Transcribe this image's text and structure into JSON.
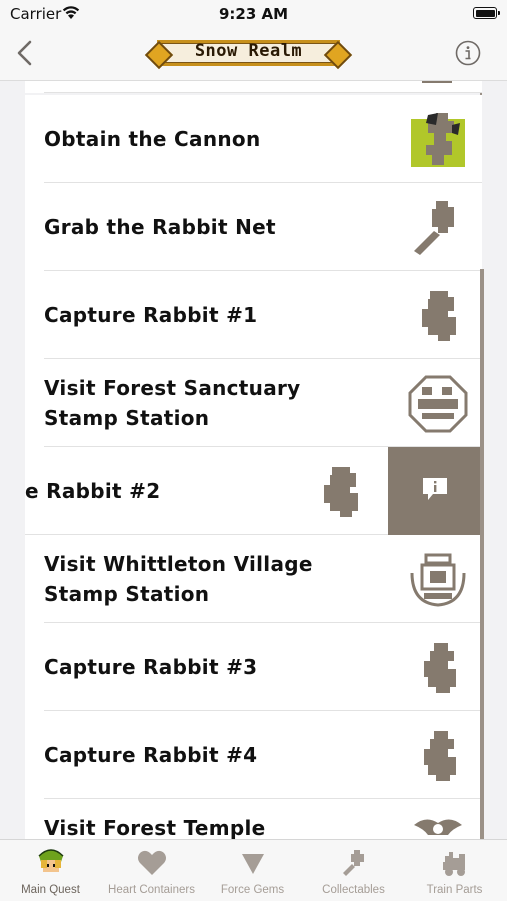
{
  "status": {
    "carrier": "Carrier",
    "time": "9:23 AM"
  },
  "nav": {
    "title": "Snow Realm"
  },
  "rows": [
    {
      "label": "Obtain the Cannon",
      "icon": "cannon-icon"
    },
    {
      "label": "Grab the Rabbit Net",
      "icon": "rabbit-net-icon"
    },
    {
      "label": "Capture Rabbit #1",
      "icon": "rabbit-icon"
    },
    {
      "label": "Visit Forest Sanctuary\nStamp Station",
      "icon": "stamp-icon"
    },
    {
      "label": "e Rabbit #2",
      "icon": "rabbit-icon"
    },
    {
      "label": "Visit Whittleton Village\nStamp Station",
      "icon": "stamp-icon"
    },
    {
      "label": "Capture Rabbit #3",
      "icon": "rabbit-icon"
    },
    {
      "label": "Capture Rabbit #4",
      "icon": "rabbit-icon"
    },
    {
      "label": "Visit Forest Temple",
      "icon": "forest-temple-icon"
    }
  ],
  "tabs": [
    {
      "label": "Main Quest",
      "icon": "link-head-icon"
    },
    {
      "label": "Heart Containers",
      "icon": "heart-icon"
    },
    {
      "label": "Force Gems",
      "icon": "gem-icon"
    },
    {
      "label": "Collectables",
      "icon": "collectable-icon"
    },
    {
      "label": "Train Parts",
      "icon": "train-icon"
    }
  ],
  "colors": {
    "accent": "#857a6e",
    "icon_brown": "#857a6e",
    "tab_inactive": "#a59d96",
    "banner_gold": "#c7901c"
  }
}
